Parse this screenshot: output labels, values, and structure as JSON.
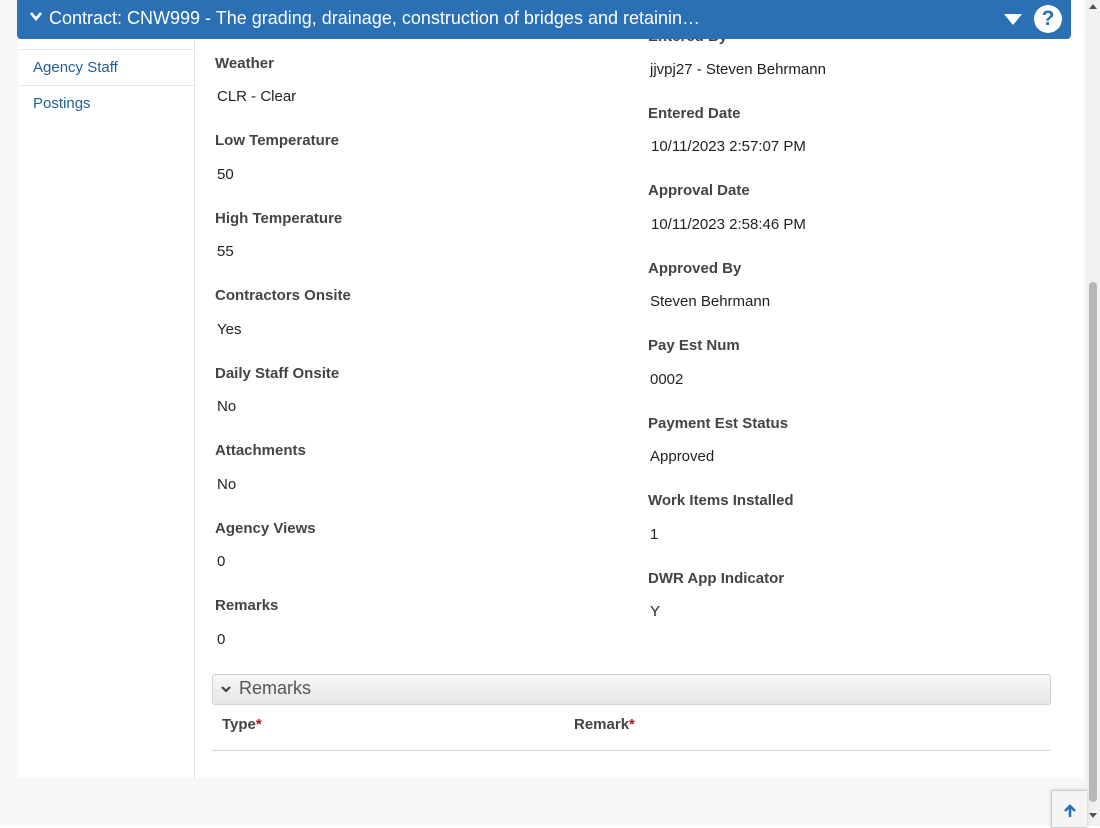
{
  "header": {
    "title": "Contract: CNW999 - The grading, drainage, construction of bridges and retainin…",
    "help_label": "?"
  },
  "sidebar": {
    "items": [
      {
        "label": "Agency Staff"
      },
      {
        "label": "Postings"
      }
    ]
  },
  "partial_label": "Entered By",
  "left_fields": [
    {
      "label": "Weather",
      "value": "CLR - Clear"
    },
    {
      "label": "Low Temperature",
      "value": "50"
    },
    {
      "label": "High Temperature",
      "value": "55"
    },
    {
      "label": "Contractors Onsite",
      "value": "Yes"
    },
    {
      "label": "Daily Staff Onsite",
      "value": "No"
    },
    {
      "label": "Attachments",
      "value": "No"
    },
    {
      "label": "Agency Views",
      "value": "0"
    },
    {
      "label": "Remarks",
      "value": "0"
    }
  ],
  "right_fields": [
    {
      "label": "Entered By",
      "value": "jjvpj27 - Steven Behrmann"
    },
    {
      "label": "Entered Date",
      "value": "10/11/2023 2:57:07 PM"
    },
    {
      "label": "Approval Date",
      "value": "10/11/2023 2:58:46 PM"
    },
    {
      "label": "Approved By",
      "value": "Steven Behrmann"
    },
    {
      "label": "Pay Est Num",
      "value": "0002"
    },
    {
      "label": "Payment Est Status",
      "value": "Approved"
    },
    {
      "label": "Work Items Installed",
      "value": "1"
    },
    {
      "label": "DWR App Indicator",
      "value": "Y"
    }
  ],
  "remarks_section": {
    "title": "Remarks",
    "columns": [
      {
        "label": "Type",
        "required_mark": "*"
      },
      {
        "label": "Remark",
        "required_mark": "*"
      }
    ]
  },
  "colors": {
    "header_bg": "#2b6fb5",
    "link": "#1f5f9a",
    "required": "#b0141b"
  },
  "icons": [
    "chevron-down-icon",
    "caret-down-icon",
    "help-icon",
    "arrow-up-icon"
  ]
}
